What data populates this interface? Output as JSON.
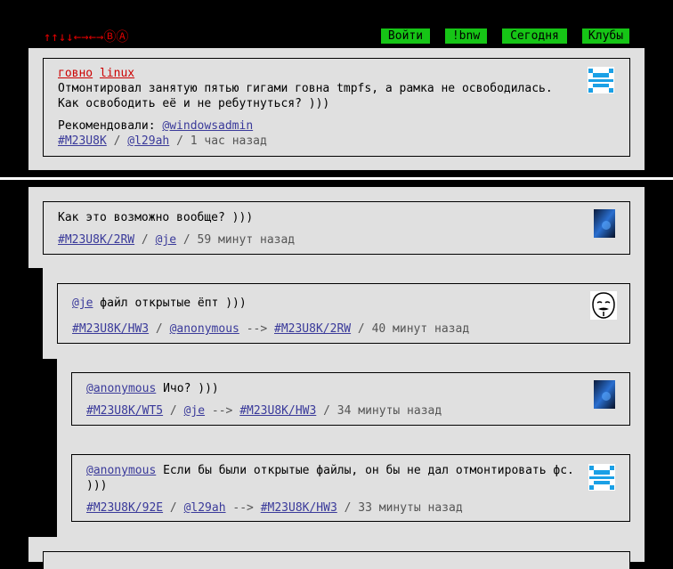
{
  "header": {
    "logo": "↑↑↓↓←→←→ⒷⒶ",
    "nav": [
      "Войти",
      "!bnw",
      "Сегодня",
      "Клубы"
    ]
  },
  "post": {
    "tags": [
      "говно",
      "linux"
    ],
    "text_line1": "Отмонтировал занятую пятью гигами говна tmpfs, а рамка не освободилась.",
    "text_line2": "Как освободить её и не ребутнуться? )))",
    "recommended_label": "Рекомендовали:",
    "recommended_user": "@windowsadmin",
    "id": "#M23U8K",
    "sep": "/",
    "author": "@l29ah",
    "time": "1 час назад"
  },
  "comments": [
    {
      "text": "Как это возможно вообще? )))",
      "id": "#M23U8K/2RW",
      "author": "@je",
      "time": "59 минут назад"
    },
    {
      "mention": "@je",
      "text": " файл открытые ёпт )))",
      "id": "#M23U8K/HW3",
      "author": "@anonymous",
      "arrow": "-->",
      "reply_to": "#M23U8K/2RW",
      "time": "40 минут назад"
    },
    {
      "mention": "@anonymous",
      "text": " Ичо? )))",
      "id": "#M23U8K/WT5",
      "author": "@je",
      "arrow": "-->",
      "reply_to": "#M23U8K/HW3",
      "time": "34 минуты назад"
    },
    {
      "mention": "@anonymous",
      "text_line1": " Если бы были открытые файлы, он бы не дал отмонтировать фс.",
      "text_line2": ")))",
      "id": "#M23U8K/92E",
      "author": "@l29ah",
      "arrow": "-->",
      "reply_to": "#M23U8K/HW3",
      "time": "33 минуты назад"
    }
  ],
  "colors": {
    "accent_green": "#16c516",
    "logo_red": "#dd0000",
    "link_blue": "#3a3a9a",
    "panel_gray": "#e0e0e0"
  }
}
